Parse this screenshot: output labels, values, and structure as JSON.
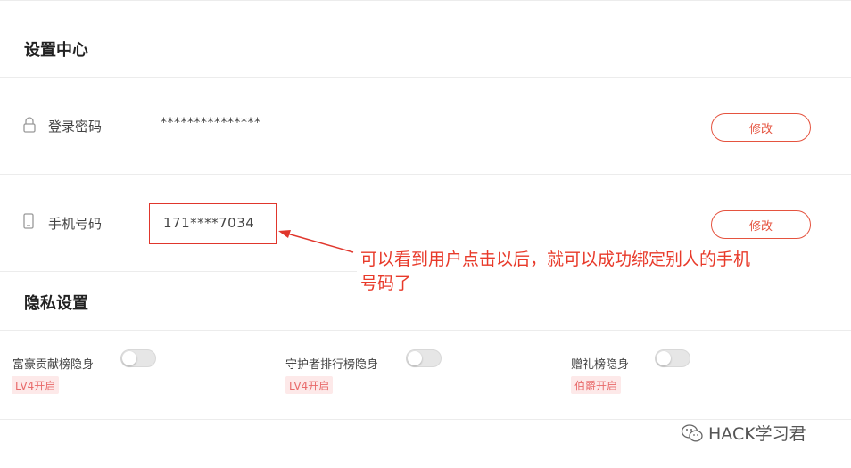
{
  "settings_center": {
    "title": "设置中心"
  },
  "password_row": {
    "label": "登录密码",
    "value": "***************",
    "button": "修改"
  },
  "phone_row": {
    "label": "手机号码",
    "value": "171****7034",
    "button": "修改"
  },
  "annotation": {
    "line1": "可以看到用户点击以后，就可以成功绑定别人的手机",
    "line2": "号码了",
    "color": "#e83a2a"
  },
  "privacy": {
    "title": "隐私设置",
    "items": [
      {
        "label": "富豪贡献榜隐身",
        "badge": "LV4开启",
        "enabled": false
      },
      {
        "label": "守护者排行榜隐身",
        "badge": "LV4开启",
        "enabled": false
      },
      {
        "label": "赠礼榜隐身",
        "badge": "伯爵开启",
        "enabled": false
      }
    ]
  },
  "watermark": {
    "text": "HACK学习君",
    "icon": "wechat-icon"
  },
  "colors": {
    "accent": "#e5533f",
    "badge_bg": "#fde9e9",
    "badge_text": "#e86a6a"
  }
}
